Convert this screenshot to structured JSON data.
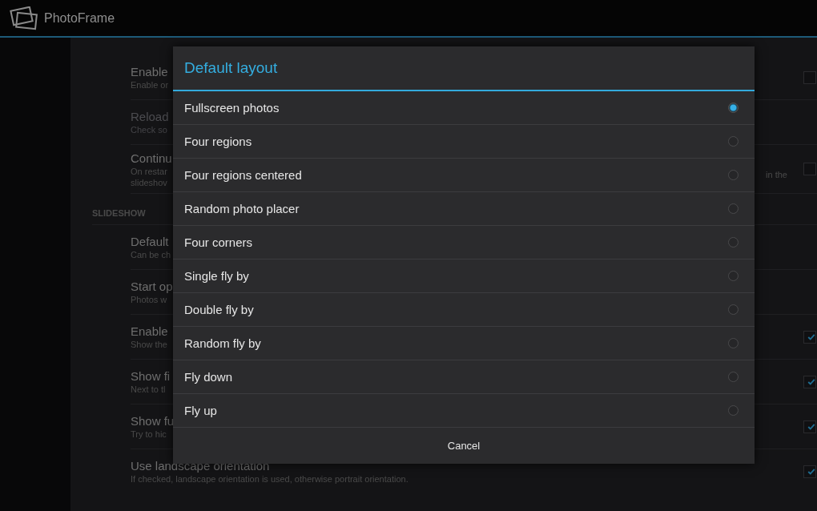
{
  "action_bar": {
    "title": "PhotoFrame"
  },
  "settings": [
    {
      "kind": "pref",
      "title": "Enable",
      "summary": [
        "Enable or"
      ],
      "disabled": false,
      "checked": false
    },
    {
      "kind": "pref",
      "title": "Reload",
      "summary": [
        "Check so"
      ],
      "disabled": true
    },
    {
      "kind": "pref",
      "title": "Continu",
      "summary": [
        "On restar",
        "slideshov"
      ],
      "right_text": "in the",
      "disabled": false,
      "checked": false
    },
    {
      "kind": "header",
      "title": "SLIDESHOW"
    },
    {
      "kind": "pref",
      "title": "Default",
      "summary": [
        "Can be ch"
      ],
      "disabled": false
    },
    {
      "kind": "pref",
      "title": "Start op",
      "summary": [
        "Photos w"
      ],
      "disabled": false
    },
    {
      "kind": "pref",
      "title": "Enable",
      "summary": [
        "Show the"
      ],
      "disabled": false,
      "checked": true
    },
    {
      "kind": "pref",
      "title": "Show fi",
      "summary": [
        "Next to tl"
      ],
      "disabled": false,
      "checked": true
    },
    {
      "kind": "pref",
      "title": "Show fu",
      "summary": [
        "Try to hic"
      ],
      "disabled": false,
      "checked": true
    },
    {
      "kind": "pref",
      "title": "Use landscape orientation",
      "summary": [
        "If checked, landscape orientation is used, otherwise portrait orientation."
      ],
      "disabled": false,
      "checked": true
    }
  ],
  "dialog": {
    "title": "Default layout",
    "options": [
      {
        "label": "Fullscreen photos",
        "selected": true
      },
      {
        "label": "Four regions",
        "selected": false
      },
      {
        "label": "Four regions centered",
        "selected": false
      },
      {
        "label": "Random photo placer",
        "selected": false
      },
      {
        "label": "Four corners",
        "selected": false
      },
      {
        "label": "Single fly by",
        "selected": false
      },
      {
        "label": "Double fly by",
        "selected": false
      },
      {
        "label": "Random fly by",
        "selected": false
      },
      {
        "label": "Fly down",
        "selected": false
      },
      {
        "label": "Fly up",
        "selected": false
      }
    ],
    "button": "Cancel"
  }
}
